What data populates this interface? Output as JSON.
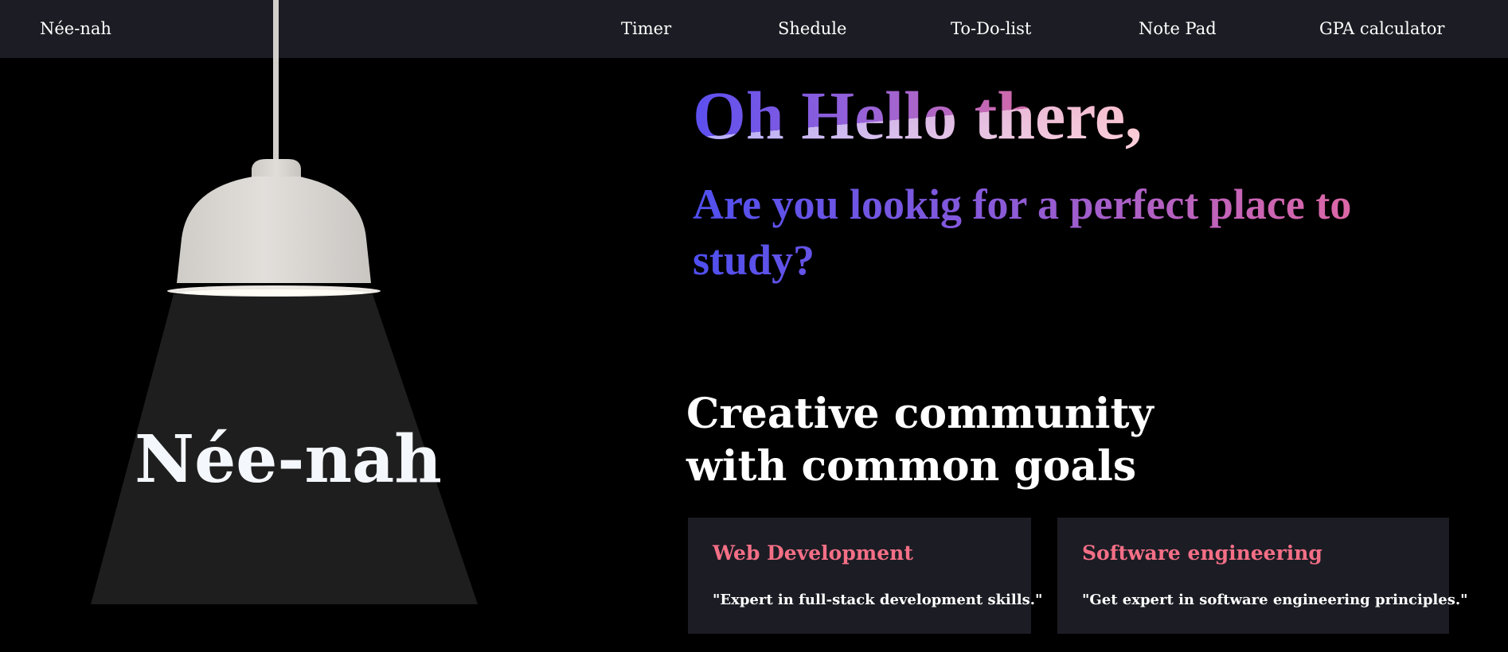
{
  "navbar": {
    "brand": "Née-nah",
    "links": [
      {
        "label": "Timer"
      },
      {
        "label": "Shedule"
      },
      {
        "label": "To-Do-list"
      },
      {
        "label": "Note Pad"
      },
      {
        "label": "GPA calculator"
      }
    ]
  },
  "lamp": {
    "title": "Née-nah"
  },
  "hero": {
    "greeting": "Oh Hello there,",
    "question": "Are you lookig for a perfect place to study?",
    "gradient_colors": [
      "#4f4ff0",
      "#9b63d6",
      "#f06d8c"
    ]
  },
  "community": {
    "heading_line1": "Creative community",
    "heading_line2": "with common goals",
    "cards": [
      {
        "title": "Web Development",
        "quote": "\"Expert in full-stack development skills.\""
      },
      {
        "title": "Software engineering",
        "quote": "\"Get expert in software engineering principles.\""
      }
    ]
  },
  "colors": {
    "background": "#000000",
    "navbar": "#1c1c24",
    "card": "#1c1c24",
    "card_title": "#f46f86",
    "light_beam": "#1e1e1e",
    "lamp_shade": "#dcd9d5"
  }
}
